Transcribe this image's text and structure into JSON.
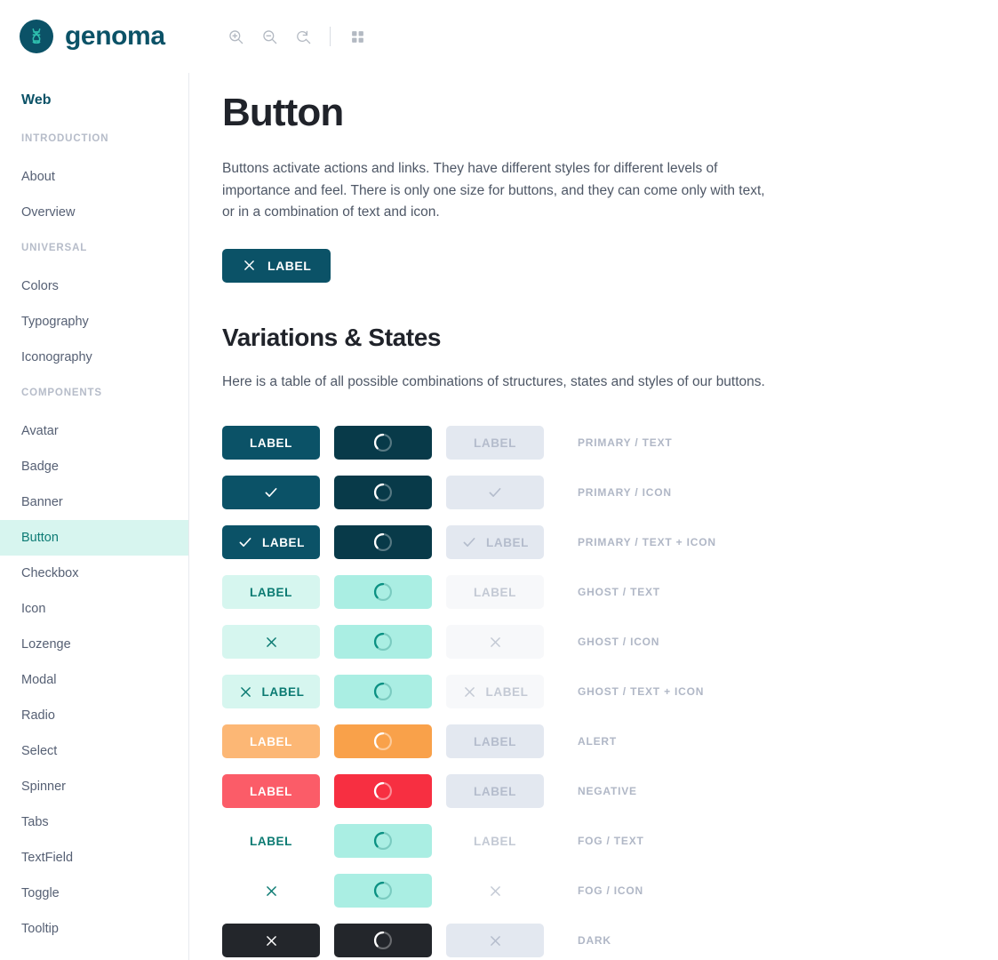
{
  "brand": {
    "name": "genoma",
    "logo_icon": "dna-helix-icon"
  },
  "toolbar": {
    "zoom_in": "zoom-in-icon",
    "zoom_out": "zoom-out-icon",
    "zoom_reset": "zoom-reset-icon",
    "grid_view": "grid-view-icon"
  },
  "sidebar": {
    "title": "Web",
    "groups": [
      {
        "label": "INTRODUCTION",
        "items": [
          {
            "label": "About",
            "active": false
          },
          {
            "label": "Overview",
            "active": false
          }
        ]
      },
      {
        "label": "UNIVERSAL",
        "items": [
          {
            "label": "Colors",
            "active": false
          },
          {
            "label": "Typography",
            "active": false
          },
          {
            "label": "Iconography",
            "active": false
          }
        ]
      },
      {
        "label": "COMPONENTS",
        "items": [
          {
            "label": "Avatar",
            "active": false
          },
          {
            "label": "Badge",
            "active": false
          },
          {
            "label": "Banner",
            "active": false
          },
          {
            "label": "Button",
            "active": true
          },
          {
            "label": "Checkbox",
            "active": false
          },
          {
            "label": "Icon",
            "active": false
          },
          {
            "label": "Lozenge",
            "active": false
          },
          {
            "label": "Modal",
            "active": false
          },
          {
            "label": "Radio",
            "active": false
          },
          {
            "label": "Select",
            "active": false
          },
          {
            "label": "Spinner",
            "active": false
          },
          {
            "label": "Tabs",
            "active": false
          },
          {
            "label": "TextField",
            "active": false
          },
          {
            "label": "Toggle",
            "active": false
          },
          {
            "label": "Tooltip",
            "active": false
          }
        ]
      }
    ]
  },
  "page": {
    "title": "Button",
    "intro": "Buttons activate actions and links. They have different styles for different levels of importance and feel. There is only one size for buttons, and they can come only with text, or in a combination of text and icon.",
    "hero_button": {
      "label": "LABEL",
      "icon": "close-x-icon"
    },
    "section_title": "Variations & States",
    "section_intro": "Here is a table of all possible combinations of structures, states and styles of our buttons."
  },
  "variations": {
    "rows": [
      {
        "label": "PRIMARY / TEXT",
        "text": "LABEL",
        "icon": "none",
        "normal": "v-primary",
        "loading": "v-primary-load",
        "disabled": "v-disabled"
      },
      {
        "label": "PRIMARY / ICON",
        "text": "",
        "icon": "check-icon",
        "normal": "v-primary",
        "loading": "v-primary-load",
        "disabled": "v-disabled"
      },
      {
        "label": "PRIMARY / TEXT + ICON",
        "text": "LABEL",
        "icon": "check-icon",
        "normal": "v-primary",
        "loading": "v-primary-load",
        "disabled": "v-disabled"
      },
      {
        "label": "GHOST / TEXT",
        "text": "LABEL",
        "icon": "none",
        "normal": "v-ghost",
        "loading": "v-ghost-load",
        "disabled": "v-disabled-soft"
      },
      {
        "label": "GHOST / ICON",
        "text": "",
        "icon": "close-x-icon",
        "normal": "v-ghost",
        "loading": "v-ghost-load",
        "disabled": "v-disabled-soft"
      },
      {
        "label": "GHOST / TEXT + ICON",
        "text": "LABEL",
        "icon": "close-x-icon",
        "normal": "v-ghost",
        "loading": "v-ghost-load",
        "disabled": "v-disabled-soft"
      },
      {
        "label": "ALERT",
        "text": "LABEL",
        "icon": "none",
        "normal": "v-alert",
        "loading": "v-alert-load",
        "disabled": "v-disabled"
      },
      {
        "label": "NEGATIVE",
        "text": "LABEL",
        "icon": "none",
        "normal": "v-negative",
        "loading": "v-negative-load",
        "disabled": "v-disabled"
      },
      {
        "label": "FOG / TEXT",
        "text": "LABEL",
        "icon": "none",
        "normal": "v-fog",
        "loading": "v-fog-load",
        "disabled": "v-disabled-none"
      },
      {
        "label": "FOG / ICON",
        "text": "",
        "icon": "close-x-icon",
        "normal": "v-fog",
        "loading": "v-fog-load",
        "disabled": "v-disabled-none"
      },
      {
        "label": "DARK",
        "text": "",
        "icon": "close-x-icon",
        "normal": "v-dark",
        "loading": "v-dark-load",
        "disabled": "v-disabled"
      }
    ]
  },
  "colors": {
    "primary": "#0b5267",
    "primary_dark": "#083a49",
    "ghost": "#d6f6ef",
    "ghost_text": "#0b7a72",
    "alert": "#fcb775",
    "negative": "#fb5c68",
    "dark": "#23262b",
    "disabled": "#e3e8f0",
    "sidebar_active": "#d7f5ef"
  }
}
